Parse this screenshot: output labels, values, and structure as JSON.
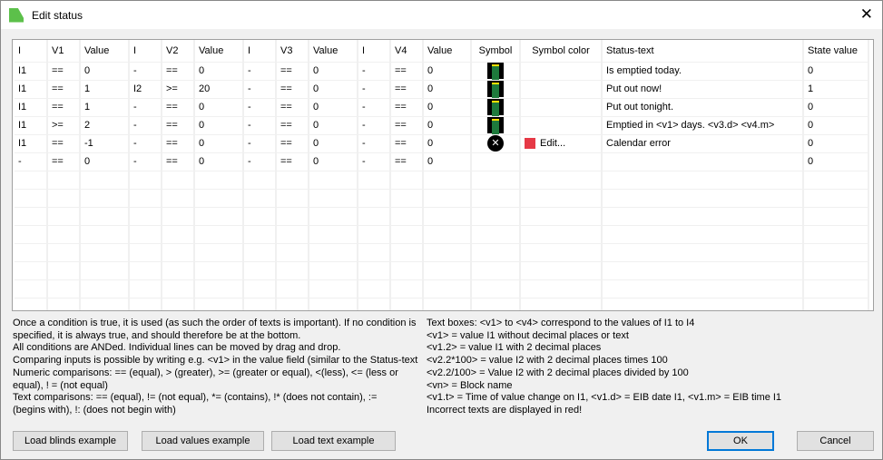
{
  "window": {
    "title": "Edit status",
    "close_icon": "close-icon"
  },
  "columns": [
    "I",
    "V1",
    "Value",
    "I",
    "V2",
    "Value",
    "I",
    "V3",
    "Value",
    "I",
    "V4",
    "Value",
    "Symbol",
    "Symbol color",
    "Status-text",
    "State value"
  ],
  "rows": [
    {
      "cells": [
        "I1",
        "==",
        "0",
        "-",
        "==",
        "0",
        "-",
        "==",
        "0",
        "-",
        "==",
        "0"
      ],
      "symbol": "bin-icon",
      "color": "",
      "status": "Is emptied today.",
      "state": "0"
    },
    {
      "cells": [
        "I1",
        "==",
        "1",
        "I2",
        ">=",
        "20",
        "-",
        "==",
        "0",
        "-",
        "==",
        "0"
      ],
      "symbol": "bin-icon",
      "color": "",
      "status": "Put out now!",
      "state": "1"
    },
    {
      "cells": [
        "I1",
        "==",
        "1",
        "-",
        "==",
        "0",
        "-",
        "==",
        "0",
        "-",
        "==",
        "0"
      ],
      "symbol": "bin-icon",
      "color": "",
      "status": "Put out tonight.",
      "state": "0"
    },
    {
      "cells": [
        "I1",
        ">=",
        "2",
        "-",
        "==",
        "0",
        "-",
        "==",
        "0",
        "-",
        "==",
        "0"
      ],
      "symbol": "bin-icon",
      "color": "",
      "status": "Emptied in <v1> days. <v3.d> <v4.m>",
      "state": "0"
    },
    {
      "cells": [
        "I1",
        "==",
        "-1",
        "-",
        "==",
        "0",
        "-",
        "==",
        "0",
        "-",
        "==",
        "0"
      ],
      "symbol": "error-x-icon",
      "color": "Edit...",
      "color_hex": "#e63946",
      "status": "Calendar error",
      "state": "0"
    },
    {
      "cells": [
        "-",
        "==",
        "0",
        "-",
        "==",
        "0",
        "-",
        "==",
        "0",
        "-",
        "==",
        "0"
      ],
      "symbol": "",
      "color": "",
      "status": "",
      "state": "0"
    }
  ],
  "help_left": [
    "Once a condition is true, it is used (as such the order of texts is important). If no condition is",
    "specified, it is always true, and should therefore be at the bottom.",
    "All conditions are ANDed. Individual lines can be moved by drag and drop.",
    "Comparing inputs is possible by writing e.g. <v1> in the value field (similar to the Status-text",
    "Numeric comparisons: == (equal), > (greater), >= (greater or equal), <(less), <= (less or",
    "equal), ! = (not equal)",
    "Text comparisons: == (equal), != (not equal), *= (contains), !* (does not contain), :=",
    "(begins with), !: (does not begin with)"
  ],
  "help_right": [
    "Text boxes: <v1> to <v4> correspond to the values of I1 to I4",
    "<v1> = value I1 without decimal places or text",
    "<v1.2> = value I1 with 2 decimal places",
    "<v2.2*100> = value I2 with 2 decimal places times 100",
    "<v2.2/100> = Value I2 with 2 decimal places divided by 100",
    "<vn> = Block name",
    "<v1.t> = Time of value change on I1, <v1.d> = EIB date I1, <v1.m> = EIB time I1",
    "Incorrect texts are displayed in red!"
  ],
  "buttons": {
    "blinds": "Load blinds example",
    "values": "Load values example",
    "text": "Load text example",
    "ok": "OK",
    "cancel": "Cancel"
  }
}
